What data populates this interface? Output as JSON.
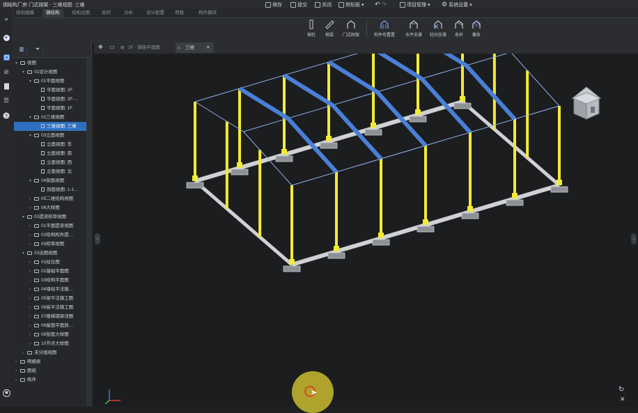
{
  "window": {
    "title": "钢结构厂房-门式刚架 - 三维视图: 三维",
    "toolbar": [
      {
        "label": "保存",
        "icon": "save-icon"
      },
      {
        "label": "提交",
        "icon": "submit-icon"
      },
      {
        "label": "关闭",
        "icon": "close-icon"
      },
      {
        "label": "剪贴板",
        "icon": "clipboard-icon",
        "dropdown": true
      },
      {
        "label": "",
        "icon": "undo-icon"
      },
      {
        "label": "项目管理",
        "icon": "project-icon",
        "dropdown": true
      },
      {
        "label": "系统设置",
        "icon": "settings-icon",
        "dropdown": true
      }
    ]
  },
  "menu_tabs": [
    "结构建模",
    "钢结构",
    "结构出图",
    "协同",
    "分析",
    "设计配置",
    "荷载",
    "构件模块"
  ],
  "active_menu_tab": 1,
  "ribbon": {
    "group1": [
      {
        "label": "钢柱",
        "icon": "steel-column-icon"
      },
      {
        "label": "钢梁",
        "icon": "steel-beam-icon"
      },
      {
        "label": "门式刚架",
        "icon": "portal-frame-icon"
      }
    ],
    "group2": [
      {
        "label": "构件布置置",
        "icon": "member-layout-icon"
      },
      {
        "label": "水平支撑",
        "icon": "horizontal-brace-icon"
      },
      {
        "label": "柱间支撑",
        "icon": "column-brace-icon"
      },
      {
        "label": "系杆",
        "icon": "tie-rod-icon"
      },
      {
        "label": "檩条",
        "icon": "purlin-icon"
      }
    ]
  },
  "tree": [
    {
      "label": "视图",
      "level": 0,
      "type": "folder",
      "expanded": true
    },
    {
      "label": "01设计视图",
      "level": 1,
      "type": "folder",
      "expanded": true
    },
    {
      "label": "01平面视图",
      "level": 2,
      "type": "folder",
      "expanded": true
    },
    {
      "label": "平面视图: 2F",
      "level": 3,
      "type": "file"
    },
    {
      "label": "平面视图: 2F-…",
      "level": 3,
      "type": "file"
    },
    {
      "label": "平面视图: 1F",
      "level": 3,
      "type": "file"
    },
    {
      "label": "02三维视图",
      "level": 2,
      "type": "folder",
      "expanded": true
    },
    {
      "label": "三维视图: 三维",
      "level": 3,
      "type": "file",
      "selected": true
    },
    {
      "label": "03立面视图",
      "level": 2,
      "type": "folder",
      "expanded": true
    },
    {
      "label": "立面视图: 东",
      "level": 3,
      "type": "file"
    },
    {
      "label": "立面视图: 南",
      "level": 3,
      "type": "file"
    },
    {
      "label": "立面视图: 西",
      "level": 3,
      "type": "file"
    },
    {
      "label": "立面视图: 北",
      "level": 3,
      "type": "file"
    },
    {
      "label": "04剖面视图",
      "level": 2,
      "type": "folder",
      "expanded": true
    },
    {
      "label": "剖面视图: 1-1…",
      "level": 3,
      "type": "file"
    },
    {
      "label": "05二维结构视图",
      "level": 2,
      "type": "folder"
    },
    {
      "label": "06大样图",
      "level": 2,
      "type": "folder"
    },
    {
      "label": "02提资校审视图",
      "level": 1,
      "type": "folder",
      "expanded": true
    },
    {
      "label": "01平面提资视图",
      "level": 2,
      "type": "folder"
    },
    {
      "label": "02结构构件提…",
      "level": 2,
      "type": "folder"
    },
    {
      "label": "03校审视图",
      "level": 2,
      "type": "folder"
    },
    {
      "label": "03出图视图",
      "level": 1,
      "type": "folder",
      "expanded": true
    },
    {
      "label": "01柱位图",
      "level": 2,
      "type": "folder"
    },
    {
      "label": "02基础平面图",
      "level": 2,
      "type": "folder"
    },
    {
      "label": "03结构平面图",
      "level": 2,
      "type": "folder"
    },
    {
      "label": "04墙柱平法施…",
      "level": 2,
      "type": "folder"
    },
    {
      "label": "05梁平法施工图",
      "level": 2,
      "type": "folder"
    },
    {
      "label": "06板平法施工图",
      "level": 2,
      "type": "folder"
    },
    {
      "label": "07楼梯钢梁详图",
      "level": 2,
      "type": "folder"
    },
    {
      "label": "08屋面平面放…",
      "level": 2,
      "type": "folder"
    },
    {
      "label": "09剖面大样图",
      "level": 2,
      "type": "folder"
    },
    {
      "label": "10节点大样图",
      "level": 2,
      "type": "folder"
    },
    {
      "label": "未分组视图",
      "level": 1,
      "type": "folder"
    },
    {
      "label": "明细表",
      "level": 0,
      "type": "folder"
    },
    {
      "label": "图纸",
      "level": 0,
      "type": "folder"
    },
    {
      "label": "构件",
      "level": 0,
      "type": "folder"
    }
  ],
  "doc_tabs": [
    {
      "label": "2F - 钢梁平面图",
      "active": false
    },
    {
      "label": "三维",
      "active": true
    }
  ],
  "colors": {
    "column": "#f2ea36",
    "beam_wire": "#8fb4f0",
    "rafter": "#4a7fd8",
    "foundation": "#cfd1d4",
    "selection": "#2f6fbf",
    "background": "#1c1d1f"
  }
}
